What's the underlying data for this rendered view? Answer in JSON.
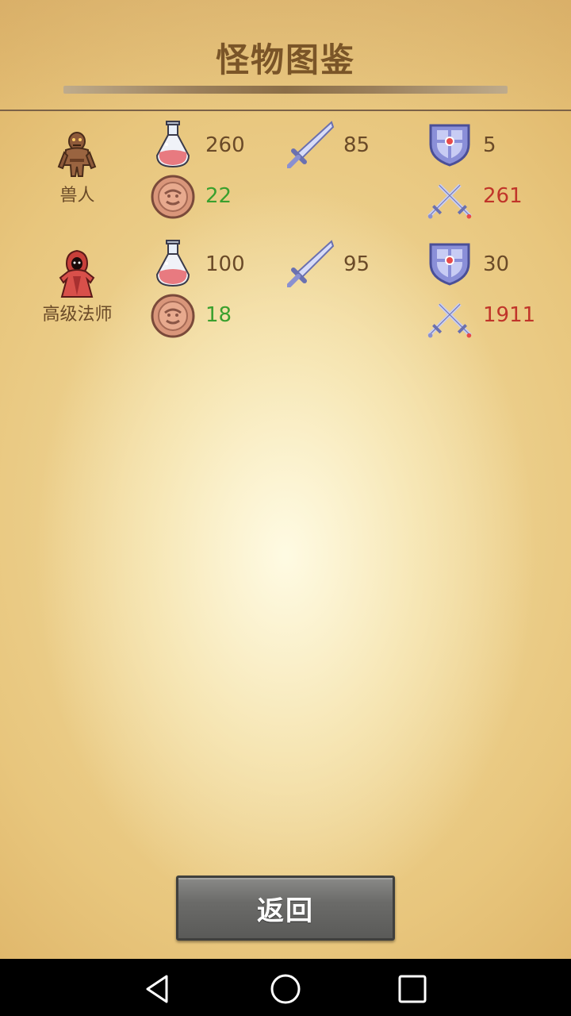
{
  "title": "怪物图鉴",
  "monsters": [
    {
      "name": "兽人",
      "icon": "orc-icon",
      "hp": "260",
      "attack": "85",
      "defense": "5",
      "gold": "22",
      "damage": "261"
    },
    {
      "name": "高级法师",
      "icon": "high-mage-icon",
      "hp": "100",
      "attack": "95",
      "defense": "30",
      "gold": "18",
      "damage": "1911"
    }
  ],
  "back_label": "返回",
  "colors": {
    "gold_value": "#3aa02e",
    "damage_value": "#c0352a",
    "text": "#6a4a28"
  }
}
